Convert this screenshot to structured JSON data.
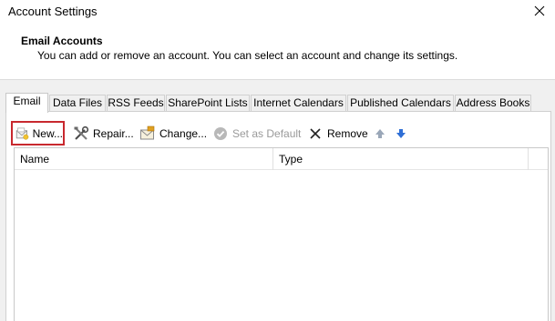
{
  "window": {
    "title": "Account Settings",
    "close_icon": "close-icon"
  },
  "header": {
    "title": "Email Accounts",
    "description": "You can add or remove an account. You can select an account and change its settings."
  },
  "tabs": [
    {
      "label": "Email",
      "active": true
    },
    {
      "label": "Data Files",
      "active": false
    },
    {
      "label": "RSS Feeds",
      "active": false
    },
    {
      "label": "SharePoint Lists",
      "active": false
    },
    {
      "label": "Internet Calendars",
      "active": false
    },
    {
      "label": "Published Calendars",
      "active": false
    },
    {
      "label": "Address Books",
      "active": false
    }
  ],
  "toolbar": {
    "new_label": "New...",
    "repair_label": "Repair...",
    "change_label": "Change...",
    "set_default_label": "Set as Default",
    "remove_label": "Remove",
    "highlight_color": "#c8282e",
    "arrow_up_color": "#9aa7b8",
    "arrow_down_color": "#2f6fd6"
  },
  "list": {
    "columns": [
      "Name",
      "Type"
    ],
    "rows": []
  }
}
